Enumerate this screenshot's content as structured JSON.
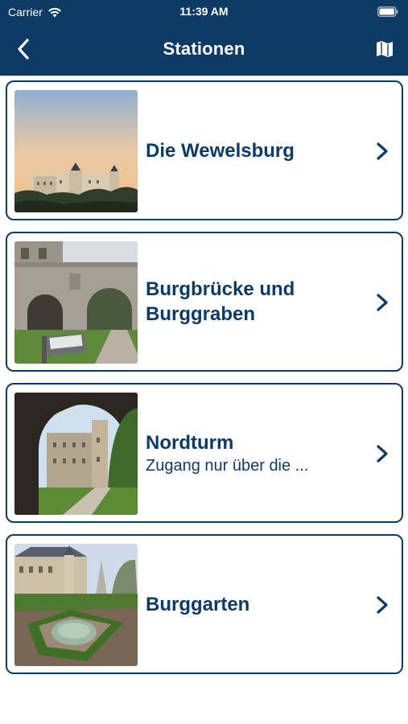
{
  "status_bar": {
    "carrier": "Carrier",
    "time": "11:39 AM"
  },
  "nav": {
    "title": "Stationen",
    "back_icon": "chevron-left-icon",
    "map_icon": "map-icon"
  },
  "stations": [
    {
      "title": "Die Wewelsburg",
      "subtitle": ""
    },
    {
      "title": "Burgbrücke und Burggraben",
      "subtitle": ""
    },
    {
      "title": "Nordturm",
      "subtitle": "Zugang nur über die ..."
    },
    {
      "title": "Burggarten",
      "subtitle": ""
    }
  ],
  "colors": {
    "primary": "#0d3b66",
    "background": "#ffffff"
  }
}
